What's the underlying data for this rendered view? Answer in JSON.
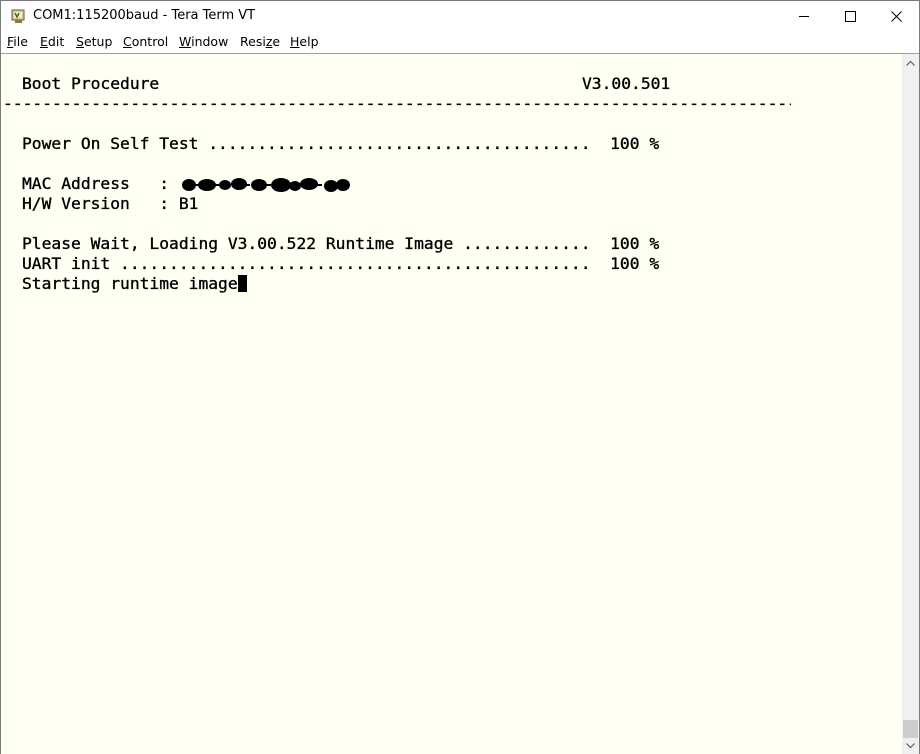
{
  "window": {
    "title": "COM1:115200baud - Tera Term VT",
    "app_icon": "teraterm-icon"
  },
  "menu": {
    "items": [
      {
        "label": "File",
        "mnemonic": "F"
      },
      {
        "label": "Edit",
        "mnemonic": "E"
      },
      {
        "label": "Setup",
        "mnemonic": "S"
      },
      {
        "label": "Control",
        "mnemonic": "C"
      },
      {
        "label": "Window",
        "mnemonic": "W"
      },
      {
        "label": "Resize",
        "mnemonic": "z"
      },
      {
        "label": "Help",
        "mnemonic": "H"
      }
    ]
  },
  "terminal": {
    "background": "#fffff3",
    "foreground": "#000000",
    "header_title": "Boot Procedure",
    "header_version": "V3.00.501",
    "divider": "--------------------------------------------------------------------------------------------",
    "lines": {
      "post": "Power On Self Test .......................................  100 %",
      "mac": "MAC Address   : ",
      "hw": "H/W Version   : B1",
      "loading": "Please Wait, Loading V3.00.522 Runtime Image .............  100 %",
      "uart": "UART init ................................................  100 %",
      "starting": "Starting runtime image"
    },
    "mac_value_redacted": true
  }
}
